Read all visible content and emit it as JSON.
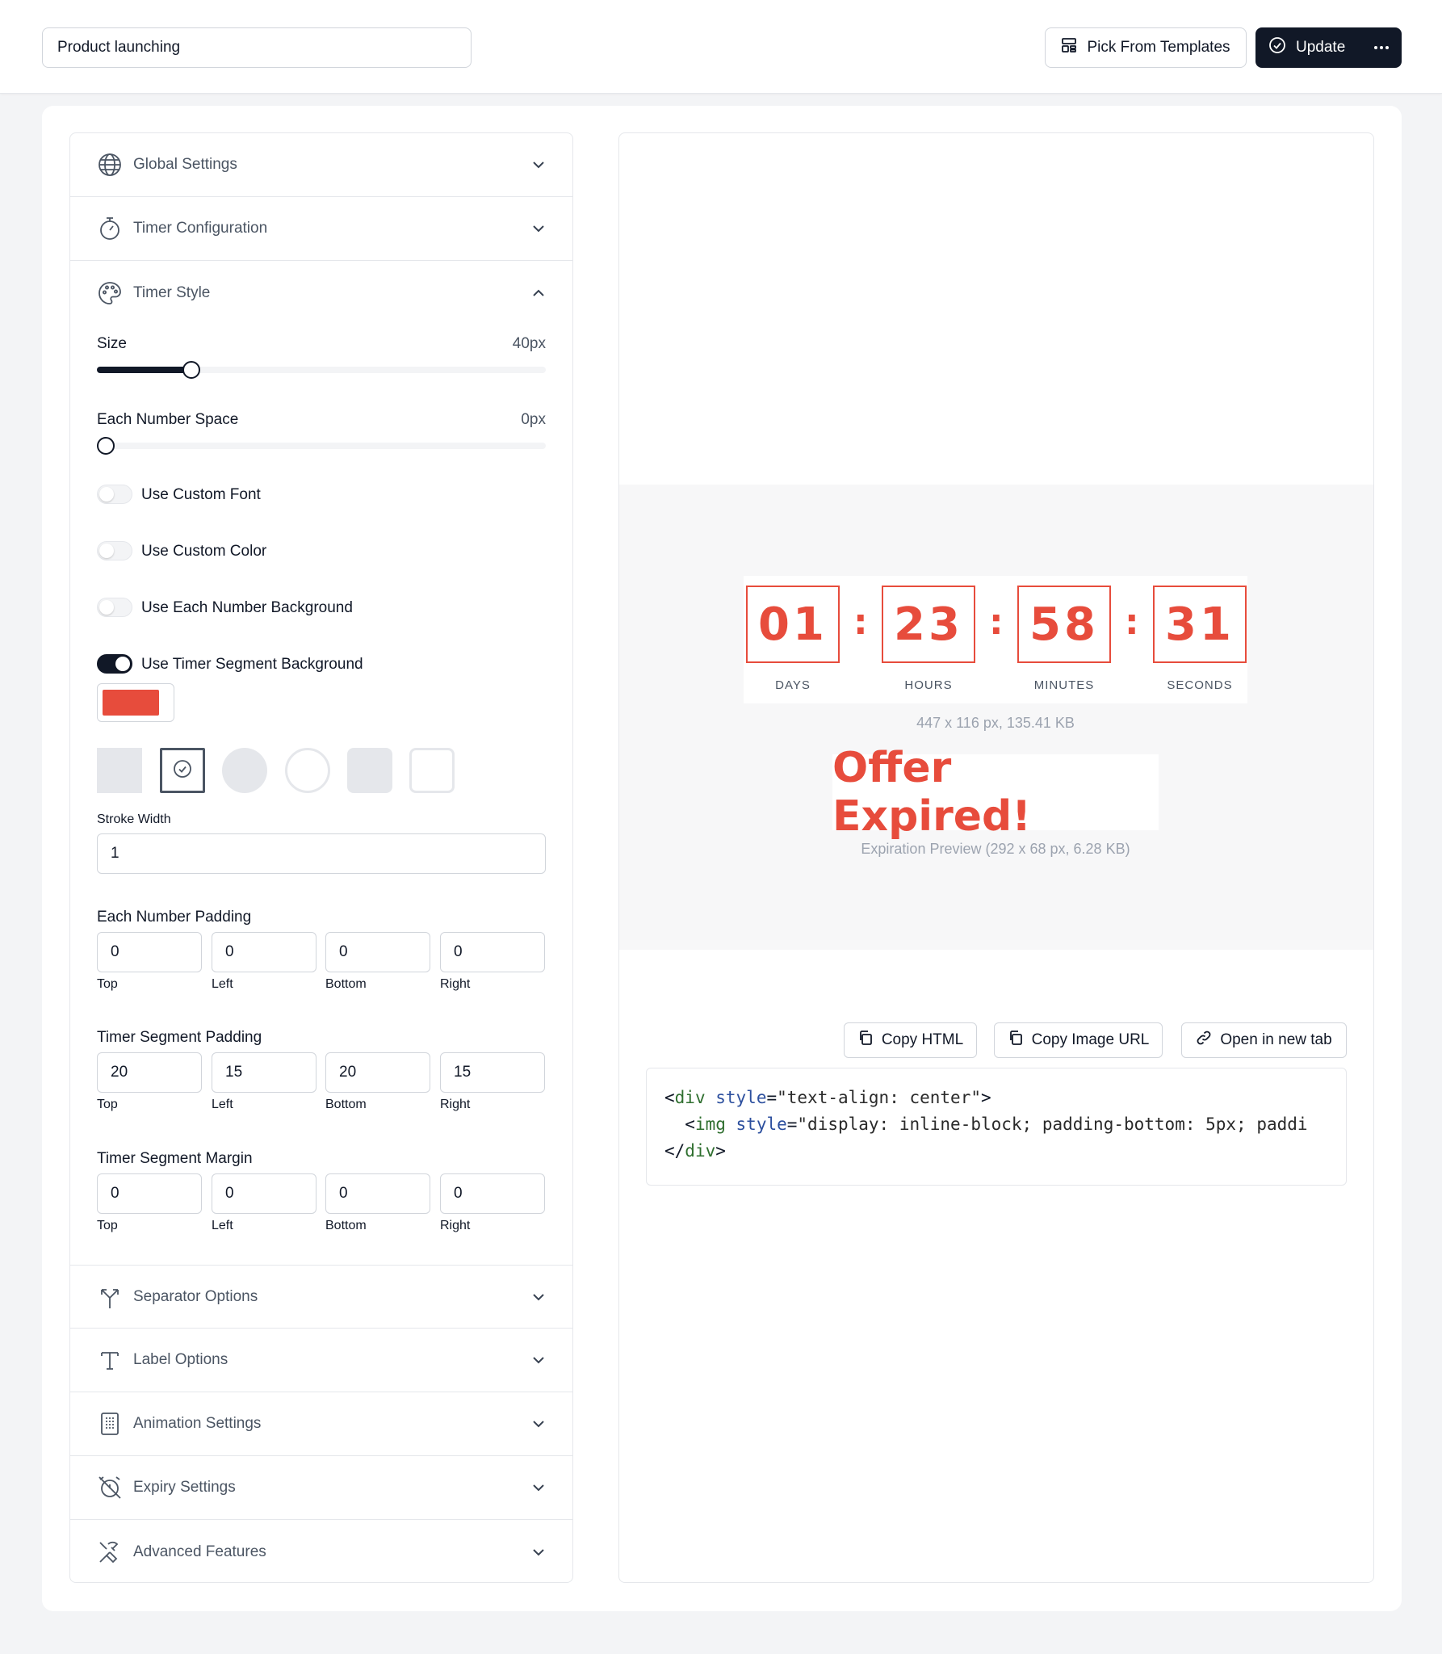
{
  "header": {
    "title_value": "Product launching",
    "templates_label": "Pick From Templates",
    "update_label": "Update"
  },
  "sections": {
    "global": "Global Settings",
    "timer_config": "Timer Configuration",
    "timer_style": "Timer Style",
    "separator": "Separator Options",
    "label": "Label Options",
    "animation": "Animation Settings",
    "expiry": "Expiry Settings",
    "advanced": "Advanced Features"
  },
  "timer_style": {
    "size_label": "Size",
    "size_value": "40px",
    "size_fraction": 0.21,
    "space_label": "Each Number Space",
    "space_value": "0px",
    "space_fraction": 0.0,
    "toggles": [
      {
        "label": "Use Custom Font",
        "on": false
      },
      {
        "label": "Use Custom Color",
        "on": false
      },
      {
        "label": "Use Each Number Background",
        "on": false
      },
      {
        "label": "Use Timer Segment Background",
        "on": true
      }
    ],
    "segment_bg_color": "#e74c3c",
    "stroke_width_label": "Stroke Width",
    "stroke_width_value": "1",
    "number_padding": {
      "title": "Each Number Padding",
      "values": [
        "0",
        "0",
        "0",
        "0"
      ],
      "labels": [
        "Top",
        "Left",
        "Bottom",
        "Right"
      ]
    },
    "segment_padding": {
      "title": "Timer Segment Padding",
      "values": [
        "20",
        "15",
        "20",
        "15"
      ],
      "labels": [
        "Top",
        "Left",
        "Bottom",
        "Right"
      ]
    },
    "segment_margin": {
      "title": "Timer Segment Margin",
      "values": [
        "0",
        "0",
        "0",
        "0"
      ],
      "labels": [
        "Top",
        "Left",
        "Bottom",
        "Right"
      ]
    }
  },
  "preview": {
    "digits": [
      "01",
      "23",
      "58",
      "31"
    ],
    "units": [
      "DAYS",
      "HOURS",
      "MINUTES",
      "SECONDS"
    ],
    "separator": ":",
    "image_meta": "447 x 116 px, 135.41 KB",
    "expired_text": "Offer Expired!",
    "expired_meta": "Expiration Preview (292 x 68 px, 6.28 KB)",
    "accent_color": "#e74c3c"
  },
  "actions": {
    "copy_html": "Copy HTML",
    "copy_image_url": "Copy Image URL",
    "open_new_tab": "Open in new tab"
  },
  "code": {
    "line1_tag": "div",
    "line1_attr": "style",
    "line1_val": "\"text-align: center\"",
    "line2_tag": "img",
    "line2_attr": "style",
    "line2_val": "\"display: inline-block; padding-bottom: 5px; paddi",
    "line3_tag": "div"
  },
  "icons": {
    "globe": "globe-icon",
    "timer": "stopwatch-icon",
    "palette": "palette-icon",
    "separator": "split-arrows-icon",
    "label": "text-t-icon",
    "animation": "grid-device-icon",
    "expiry": "alarm-off-icon",
    "advanced": "tools-icon"
  }
}
